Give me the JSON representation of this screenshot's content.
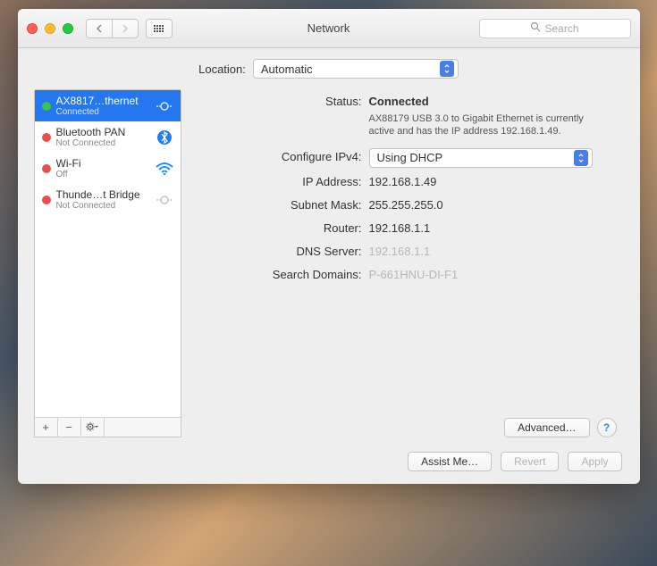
{
  "window": {
    "title": "Network"
  },
  "toolbar": {
    "search_placeholder": "Search"
  },
  "location": {
    "label": "Location:",
    "value": "Automatic"
  },
  "sidebar": {
    "items": [
      {
        "name": "AX8817…thernet",
        "status_label": "Connected",
        "status": "green",
        "icon": "ethernet"
      },
      {
        "name": "Bluetooth PAN",
        "status_label": "Not Connected",
        "status": "red",
        "icon": "bluetooth"
      },
      {
        "name": "Wi-Fi",
        "status_label": "Off",
        "status": "red",
        "icon": "wifi"
      },
      {
        "name": "Thunde…t Bridge",
        "status_label": "Not Connected",
        "status": "red",
        "icon": "ethernet-gray"
      }
    ]
  },
  "detail": {
    "status_label": "Status:",
    "status_value": "Connected",
    "status_desc": "AX88179 USB 3.0 to Gigabit Ethernet is currently active and has the IP address 192.168.1.49.",
    "configure_label": "Configure IPv4:",
    "configure_value": "Using DHCP",
    "ip_label": "IP Address:",
    "ip_value": "192.168.1.49",
    "subnet_label": "Subnet Mask:",
    "subnet_value": "255.255.255.0",
    "router_label": "Router:",
    "router_value": "192.168.1.1",
    "dns_label": "DNS Server:",
    "dns_value": "192.168.1.1",
    "search_label": "Search Domains:",
    "search_value": "P-661HNU-DI-F1"
  },
  "buttons": {
    "advanced": "Advanced…",
    "assist": "Assist Me…",
    "revert": "Revert",
    "apply": "Apply",
    "help": "?"
  }
}
